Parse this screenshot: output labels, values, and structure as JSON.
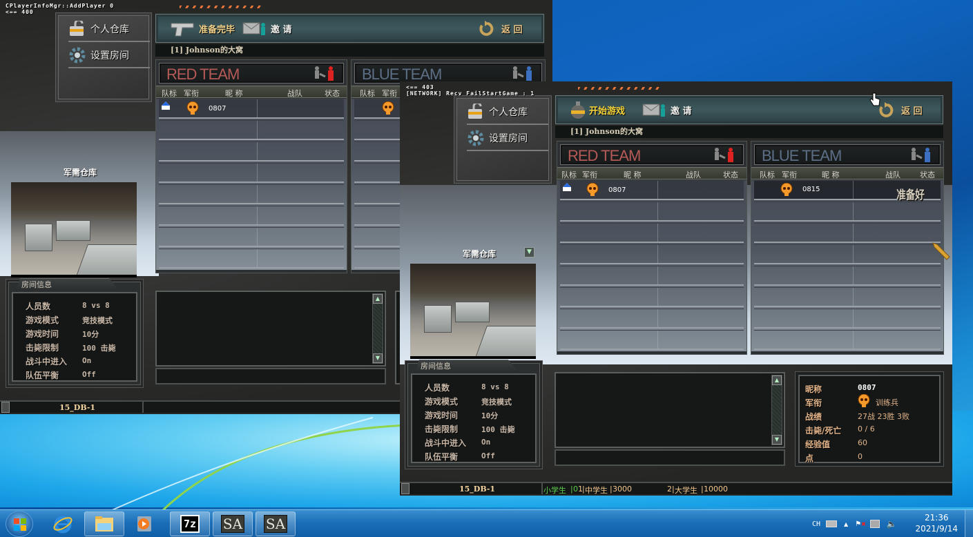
{
  "debug": {
    "back_line1": "CPlayerInfoMgr::AddPlayer 0",
    "back_line2": "<== 400",
    "front_line1": "<== 403",
    "front_line2": "[NETWORK] Recv FailStartGame : 1"
  },
  "back_window": {
    "side_menu": [
      {
        "label": "个人仓库",
        "icon": "warehouse-lock-icon"
      },
      {
        "label": "设置房间",
        "icon": "gear-icon"
      }
    ],
    "toolbar": {
      "ready_label": "准备完毕",
      "invite_label": "邀 请",
      "back_label": "返 回"
    },
    "room_title": "[1] Johnson的大窝",
    "red_team": {
      "name": "RED TEAM",
      "columns": [
        "队标",
        "军衔",
        "昵 称",
        "战队",
        "状态"
      ],
      "players": [
        {
          "nick": "0807",
          "host": true,
          "rank": "skull",
          "status": ""
        }
      ]
    },
    "blue_team": {
      "name": "BLUE TEAM",
      "columns": [
        "队标",
        "军衔"
      ],
      "players": [
        {
          "nick": "",
          "host": false,
          "rank": "skull",
          "status": ""
        }
      ]
    },
    "map_name": "军需仓库",
    "room_info": {
      "title": "房间信息",
      "rows": [
        {
          "label": "人员数",
          "value": "8 vs 8"
        },
        {
          "label": "游戏模式",
          "value": "竞技模式"
        },
        {
          "label": "游戏时间",
          "value": "10分"
        },
        {
          "label": "击毙限制",
          "value": "100 击毙"
        },
        {
          "label": "战斗中进入",
          "value": "On"
        },
        {
          "label": "队伍平衡",
          "value": "Off"
        }
      ]
    },
    "server": "15_DB-1"
  },
  "front_window": {
    "side_menu": [
      {
        "label": "个人仓库",
        "icon": "warehouse-lock-icon"
      },
      {
        "label": "设置房间",
        "icon": "gear-icon"
      }
    ],
    "toolbar": {
      "start_label": "开始游戏",
      "invite_label": "邀 请",
      "back_label": "返 回"
    },
    "room_title": "[1] Johnson的大窝",
    "red_team": {
      "name": "RED TEAM",
      "columns": [
        "队标",
        "军衔",
        "昵 称",
        "战队",
        "状态"
      ],
      "players": [
        {
          "nick": "0807",
          "host": true,
          "rank": "skull",
          "status": ""
        }
      ]
    },
    "blue_team": {
      "name": "BLUE TEAM",
      "columns": [
        "队标",
        "军衔",
        "昵 称",
        "战队",
        "状态"
      ],
      "players": [
        {
          "nick": "0815",
          "host": false,
          "rank": "skull",
          "status": "准备好"
        }
      ]
    },
    "map_name": "军需仓库",
    "room_info": {
      "title": "房间信息",
      "rows": [
        {
          "label": "人员数",
          "value": "8 vs 8"
        },
        {
          "label": "游戏模式",
          "value": "竞技模式"
        },
        {
          "label": "游戏时间",
          "value": "10分"
        },
        {
          "label": "击毙限制",
          "value": "100 击毙"
        },
        {
          "label": "战斗中进入",
          "value": "On"
        },
        {
          "label": "队伍平衡",
          "value": "Off"
        }
      ]
    },
    "profile": {
      "rows": [
        {
          "label": "昵称",
          "value": "0807"
        },
        {
          "label": "军衔",
          "value": "训练兵"
        },
        {
          "label": "战绩",
          "value": "27战 23胜 3败"
        },
        {
          "label": "击毙/死亡",
          "value": "0 / 6"
        },
        {
          "label": "经验值",
          "value": "60"
        },
        {
          "label": "点",
          "value": "0"
        }
      ]
    },
    "server": "15_DB-1",
    "grades": {
      "g1_name": "小学生",
      "g1_val": "0",
      "g1_sep": "1",
      "g2_name": "中学生",
      "g2_val": "3000",
      "g2_pre": "2",
      "g3_name": "大学生",
      "g3_val": "10000"
    }
  },
  "taskbar": {
    "items": [
      "start-orb",
      "internet-explorer",
      "file-explorer",
      "media-player",
      "7-zip",
      "SA",
      "SA"
    ],
    "sa_label": "SA",
    "zip_label": "7z",
    "ime": "CH",
    "time": "21:36",
    "date": "2021/9/14"
  },
  "colors": {
    "red_team": "#b55a57",
    "blue_team": "#5c6f86",
    "gold_text": "#f2c78f",
    "green_text": "#5fcf4f",
    "start_text": "#f7d53c"
  }
}
